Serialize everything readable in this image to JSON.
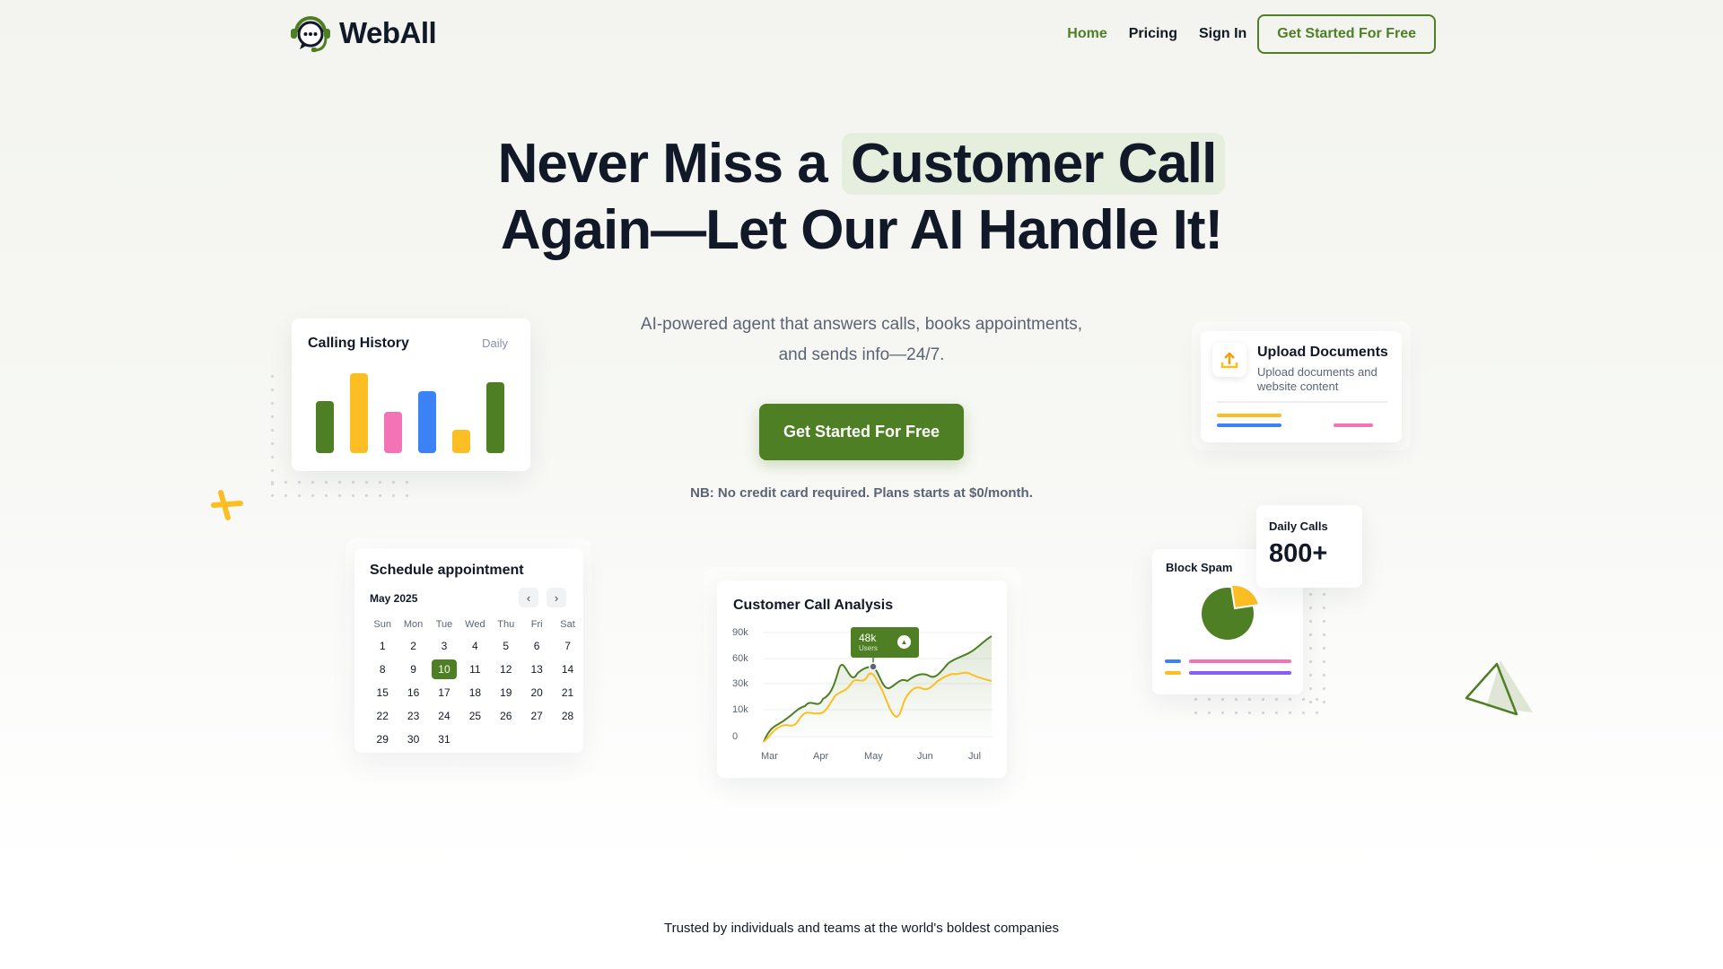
{
  "brand": {
    "name": "WebAll"
  },
  "nav": {
    "links": [
      "Home",
      "Pricing",
      "Sign In"
    ],
    "cta": "Get Started For Free"
  },
  "hero": {
    "title_part1": "Never Miss a ",
    "title_highlight": "Customer Call",
    "title_line2": "Again—Let Our AI Handle It!",
    "subtitle_line1": "AI-powered agent that answers calls, books appointments,",
    "subtitle_line2": "and sends info—24/7.",
    "cta": "Get Started For Free",
    "note": "NB: No credit card required. Plans starts at $0/month."
  },
  "calling_history": {
    "title": "Calling History",
    "period": "Daily",
    "bars": [
      {
        "value": 0.63,
        "color": "#4f7f24"
      },
      {
        "value": 0.97,
        "color": "#fbbf24"
      },
      {
        "value": 0.5,
        "color": "#f472b6"
      },
      {
        "value": 0.75,
        "color": "#3b82f6"
      },
      {
        "value": 0.28,
        "color": "#fbbf24"
      },
      {
        "value": 0.86,
        "color": "#4f7f24"
      }
    ]
  },
  "schedule": {
    "title": "Schedule appointment",
    "month": "May 2025",
    "weekdays": [
      "Sun",
      "Mon",
      "Tue",
      "Wed",
      "Thu",
      "Fri",
      "Sat"
    ],
    "days": [
      "1",
      "2",
      "3",
      "4",
      "5",
      "6",
      "7",
      "8",
      "9",
      "10",
      "11",
      "12",
      "13",
      "14",
      "15",
      "16",
      "17",
      "18",
      "19",
      "20",
      "21",
      "22",
      "23",
      "24",
      "25",
      "26",
      "27",
      "28",
      "29",
      "30",
      "31"
    ],
    "selected": "10"
  },
  "analysis": {
    "title": "Customer Call Analysis",
    "y_ticks": [
      "90k",
      "60k",
      "30k",
      "10k",
      "0"
    ],
    "x_ticks": [
      "Mar",
      "Apr",
      "May",
      "Jun",
      "Jul"
    ],
    "tooltip_value": "48k",
    "tooltip_label": "Users",
    "series_colors": [
      "#4f7f24",
      "#fbbf24"
    ]
  },
  "upload": {
    "title": "Upload Documents",
    "subtitle_line1": "Upload documents and",
    "subtitle_line2": "website content"
  },
  "daily_calls": {
    "label": "Daily Calls",
    "value": "800+"
  },
  "block_spam": {
    "title": "Block Spam"
  },
  "footer": {
    "trusted": "Trusted by individuals and teams at the world's boldest companies"
  }
}
